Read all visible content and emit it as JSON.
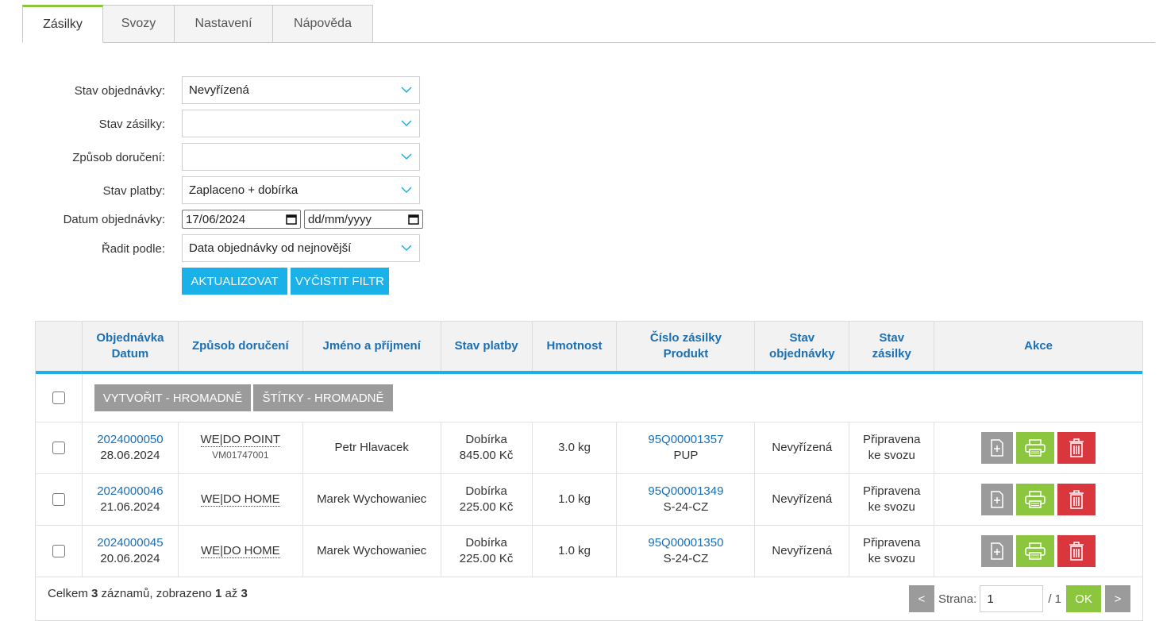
{
  "tabs": [
    "Zásilky",
    "Svozy",
    "Nastavení",
    "Nápověda"
  ],
  "filters": {
    "order_state": {
      "label": "Stav objednávky:",
      "value": "Nevyřízená"
    },
    "shipment_state": {
      "label": "Stav zásilky:",
      "value": ""
    },
    "delivery_method": {
      "label": "Způsob doručení:",
      "value": ""
    },
    "payment_state": {
      "label": "Stav platby:",
      "value": "Zaplaceno + dobírka"
    },
    "order_date": {
      "label": "Datum objednávky:",
      "from": "17/06/2024",
      "to": "dd/mm/yyyy"
    },
    "sort_by": {
      "label": "Řadit podle:",
      "value": "Data objednávky od nejnovější"
    },
    "update_button": "AKTUALIZOVAT",
    "clear_button": "VYČISTIT FILTR"
  },
  "table": {
    "headers": {
      "order": [
        "Objednávka",
        "Datum"
      ],
      "delivery": "Způsob doručení",
      "name": "Jméno a příjmení",
      "payment": "Stav platby",
      "weight": "Hmotnost",
      "shipment": [
        "Číslo zásilky",
        "Produkt"
      ],
      "order_state": [
        "Stav",
        "objednávky"
      ],
      "shipment_state": [
        "Stav",
        "zásilky"
      ],
      "actions": "Akce"
    },
    "bulk": {
      "create": "VYTVOŘIT - HROMADNĚ",
      "labels": "ŠTÍTKY - HROMADNĚ"
    },
    "rows": [
      {
        "order_id": "2024000050",
        "date": "28.06.2024",
        "delivery": "WE|DO POINT",
        "delivery_sub": "VM01747001",
        "name": "Petr Hlavacek",
        "payment": "Dobírka",
        "amount": "845.00 Kč",
        "weight": "3.0 kg",
        "shipment_no": "95Q00001357",
        "product": "PUP",
        "order_state": "Nevyřízená",
        "shipment_state_1": "Připravena",
        "shipment_state_2": "ke svozu"
      },
      {
        "order_id": "2024000046",
        "date": "21.06.2024",
        "delivery": "WE|DO HOME",
        "delivery_sub": "",
        "name": "Marek Wychowaniec",
        "payment": "Dobírka",
        "amount": "225.00 Kč",
        "weight": "1.0 kg",
        "shipment_no": "95Q00001349",
        "product": "S-24-CZ",
        "order_state": "Nevyřízená",
        "shipment_state_1": "Připravena",
        "shipment_state_2": "ke svozu"
      },
      {
        "order_id": "2024000045",
        "date": "20.06.2024",
        "delivery": "WE|DO HOME",
        "delivery_sub": "",
        "name": "Marek Wychowaniec",
        "payment": "Dobírka",
        "amount": "225.00 Kč",
        "weight": "1.0 kg",
        "shipment_no": "95Q00001350",
        "product": "S-24-CZ",
        "order_state": "Nevyřízená",
        "shipment_state_1": "Připravena",
        "shipment_state_2": "ke svozu"
      }
    ],
    "action_icons": [
      "document-plus-icon",
      "printer-icon",
      "trash-icon"
    ]
  },
  "footer": {
    "summary_prefix": "Celkem ",
    "total": "3",
    "summary_mid": " záznamů, zobrazeno ",
    "from": "1",
    "summary_to": " až ",
    "to": "3",
    "prev": "<",
    "page_label": "Strana:",
    "page_value": "1",
    "page_total": "/ 1",
    "ok": "OK",
    "next": ">"
  },
  "colors": {
    "accent_blue": "#1ab0e8",
    "link_blue": "#1b6fb3",
    "green": "#8cc63f",
    "red": "#d9363e",
    "gray": "#9b9b9b"
  }
}
